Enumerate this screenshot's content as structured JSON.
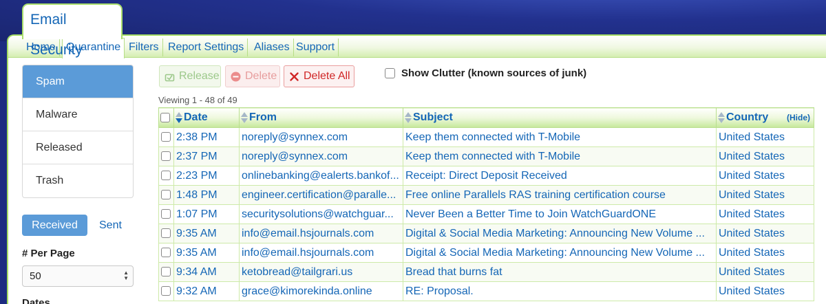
{
  "app": {
    "title": "Email Security"
  },
  "nav": {
    "items": [
      "Home",
      "Quarantine",
      "Filters",
      "Report Settings",
      "Aliases",
      "Support"
    ],
    "active": "Quarantine"
  },
  "sidebar": {
    "items": [
      "Spam",
      "Malware",
      "Released",
      "Trash"
    ],
    "active": "Spam",
    "received_label": "Received",
    "sent_label": "Sent",
    "per_page_label": "# Per Page",
    "per_page_value": "50",
    "dates_label": "Dates"
  },
  "toolbar": {
    "release_label": "Release",
    "delete_label": "Delete",
    "delete_all_label": "Delete All",
    "clutter_label": "Show Clutter (known sources of junk)"
  },
  "viewing": "Viewing 1 - 48 of 49",
  "table": {
    "columns": {
      "date": "Date",
      "from": "From",
      "subject": "Subject",
      "country": "Country",
      "hide": "(Hide)"
    },
    "rows": [
      {
        "date": "2:38 PM",
        "from": "noreply@synnex.com",
        "subject": "Keep them connected with T-Mobile",
        "country": "United States"
      },
      {
        "date": "2:37 PM",
        "from": "noreply@synnex.com",
        "subject": "Keep them connected with T-Mobile",
        "country": "United States"
      },
      {
        "date": "2:23 PM",
        "from": "onlinebanking@ealerts.bankof...",
        "subject": "Receipt: Direct Deposit Received",
        "country": "United States"
      },
      {
        "date": "1:48 PM",
        "from": "engineer.certification@paralle...",
        "subject": "Free online Parallels RAS training certification course",
        "country": "United States"
      },
      {
        "date": "1:07 PM",
        "from": "securitysolutions@watchguar...",
        "subject": "Never Been a Better Time to Join WatchGuardONE",
        "country": "United States"
      },
      {
        "date": "9:35 AM",
        "from": "info@email.hsjournals.com",
        "subject": "Digital & Social Media Marketing: Announcing New Volume ...",
        "country": "United States"
      },
      {
        "date": "9:35 AM",
        "from": "info@email.hsjournals.com",
        "subject": "Digital & Social Media Marketing: Announcing New Volume ...",
        "country": "United States"
      },
      {
        "date": "9:34 AM",
        "from": "ketobread@tailgrari.us",
        "subject": "Bread that burns fat",
        "country": "United States"
      },
      {
        "date": "9:32 AM",
        "from": "grace@kimorekinda.online",
        "subject": "RE: Proposal.",
        "country": "United States"
      }
    ]
  },
  "colors": {
    "brand_blue": "#1466b6",
    "accent_green": "#a4dc62",
    "active_blue": "#5b9bd8",
    "banner": "#22318e",
    "danger": "#d02626"
  }
}
